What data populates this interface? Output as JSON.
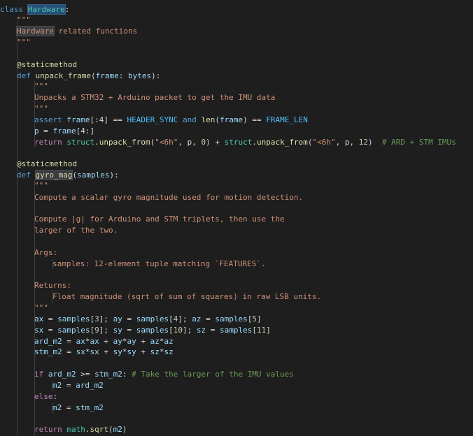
{
  "code": {
    "kw_class": "class",
    "class_name": "Hardware",
    "colon": ":",
    "doc_q": "\"\"\"",
    "doc_hw_word": "Hardware",
    "doc_hw_rest": " related functions",
    "decorator": "@staticmethod",
    "kw_def": "def",
    "f1_name": "unpack_frame",
    "f1_open": "(",
    "f1_param": "frame",
    "f1_colon": ": ",
    "f1_type": "bytes",
    "f1_close": "):",
    "f1_doc": "Unpacks a STM32 + Arduino packet to get the IMU data",
    "kw_assert": "assert",
    "frame": "frame",
    "slice4": "[:4]",
    "eq": " == ",
    "header_sync": "HEADER_SYNC",
    "kw_and": "and",
    "len": "len",
    "paren_open": "(",
    "paren_close": ")",
    "frame_len": "FRAME_LEN",
    "p": "p",
    "assign": " = ",
    "slice4b": "[4:]",
    "kw_return": "return",
    "struct": "struct",
    "unpack_from": ".unpack_from",
    "fmt": "\"<6h\"",
    "comma_p": ", p, ",
    "n0": "0",
    "plus": " + ",
    "n12": "12",
    "cmt_ard_stm": "# ARD + STM IMUs",
    "f2_name": "gyro_mag",
    "f2_param": "samples",
    "f2_doc1": "Compute a scalar gyro magnitude used for motion detection.",
    "f2_doc2": "Compute |g| for Arduino and STM triplets, then use the",
    "f2_doc3": "larger of the two.",
    "f2_doc4": "Args:",
    "f2_doc5": "samples: 12-element tuple matching `FEATURES`.",
    "f2_doc6": "Returns:",
    "f2_doc7": "Float magnitude (sqrt of sum of squares) in raw LSB units.",
    "ax": "ax",
    "ay": "ay",
    "az": "az",
    "sx": "sx",
    "sy": "sy",
    "sz": "sz",
    "samples": "samples",
    "i3": "3",
    "i4": "4",
    "i5": "5",
    "i9": "9",
    "i10": "10",
    "i11": "11",
    "lb": "[",
    "rb": "]",
    "semi": "; ",
    "ard_m2": "ard_m2",
    "stm_m2": "stm_m2",
    "mul": "*",
    "kw_if": "if",
    "gte": " >= ",
    "if_colon": ":",
    "cmt_larger": "# Take the larger of the IMU values",
    "m2": "m2",
    "kw_else": "else",
    "math": "math",
    "sqrt": ".sqrt"
  },
  "colors": {
    "background": "#1e1e1e",
    "keyword": "#569cd6",
    "control": "#c586c0",
    "class": "#4ec9b0",
    "function": "#dcdcaa",
    "variable": "#9cdcfe",
    "constant": "#4fc1ff",
    "number": "#b5cea8",
    "string": "#ce9178",
    "comment": "#6a9955"
  }
}
